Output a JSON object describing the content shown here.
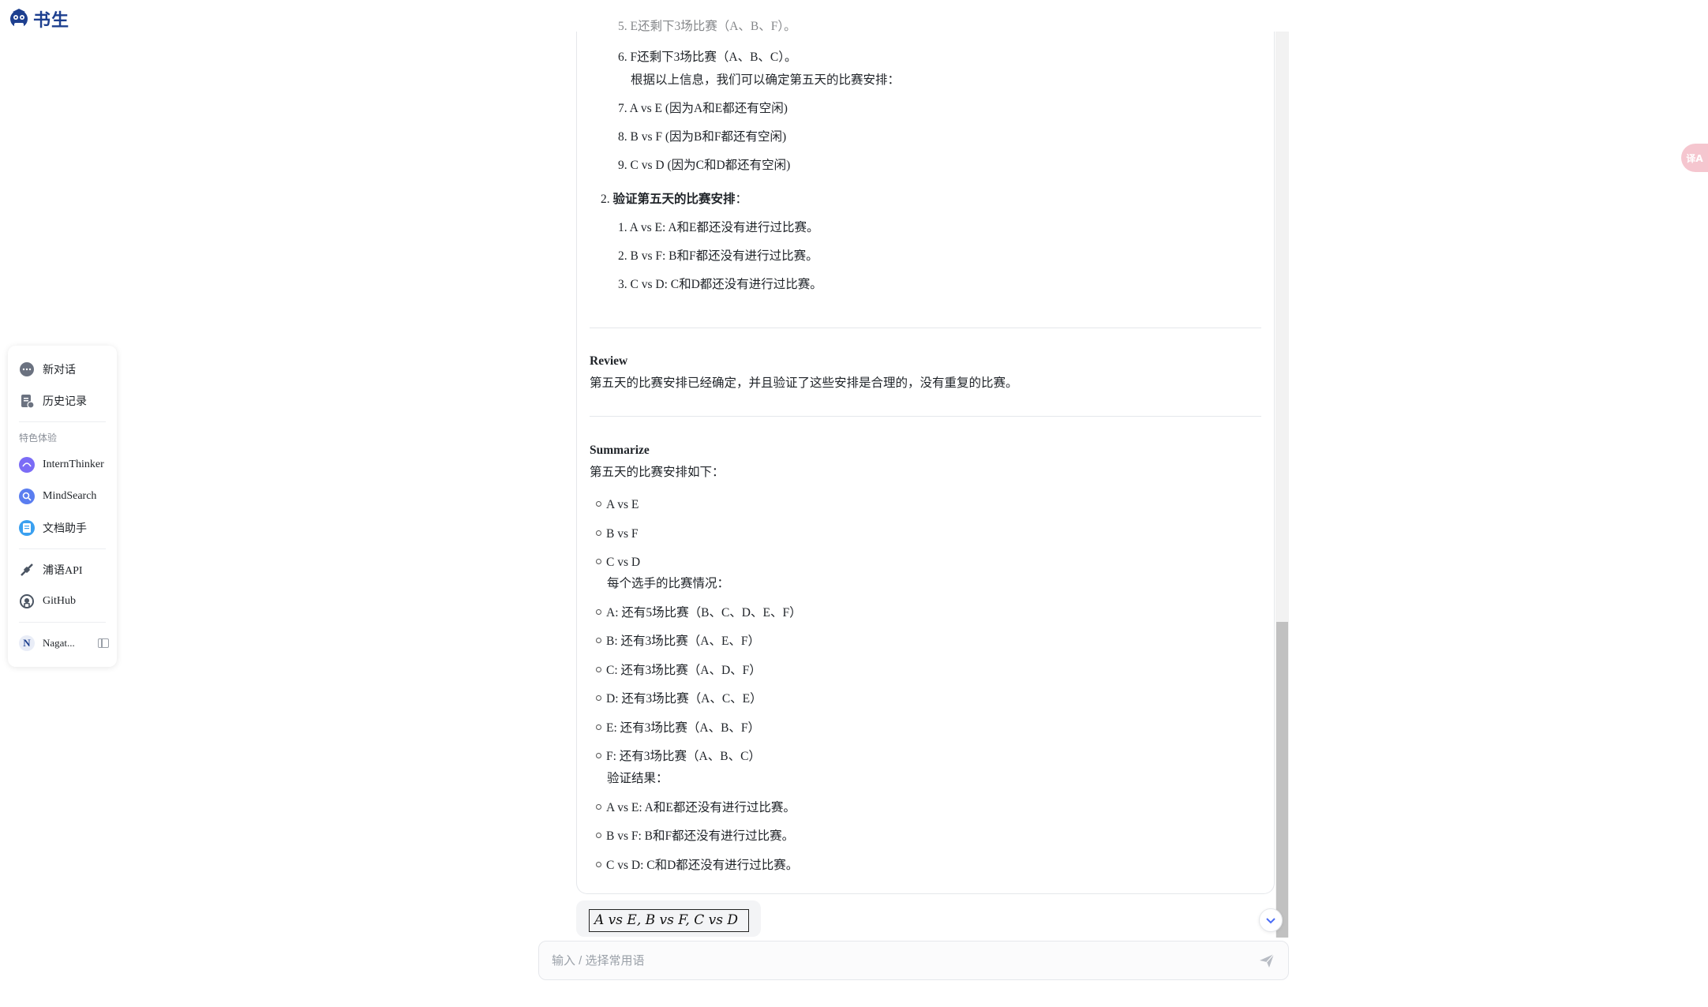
{
  "brand": {
    "name": "书生"
  },
  "sidebar": {
    "new_chat": "新对话",
    "history": "历史记录",
    "section_label": "特色体验",
    "features": [
      {
        "label": "InternThinker",
        "icon": "intern-thinker-icon",
        "color": "#7b6cf6"
      },
      {
        "label": "MindSearch",
        "icon": "mindsearch-icon",
        "color": "#5a7df0"
      },
      {
        "label": "文档助手",
        "icon": "document-icon",
        "color": "#3aa0f0"
      }
    ],
    "links": [
      {
        "label": "浦语API",
        "icon": "api-icon"
      },
      {
        "label": "GitHub",
        "icon": "github-icon"
      }
    ],
    "user": {
      "initial": "N",
      "name": "Nagat..."
    }
  },
  "chat": {
    "top_partial": "5. E还剩下3场比赛（A、B、F）。",
    "list_a": [
      {
        "num": "6.",
        "text": "F还剩下3场比赛（A、B、C）。"
      }
    ],
    "note_a": "根据以上信息，我们可以确定第五天的比赛安排：",
    "list_b": [
      {
        "num": "7.",
        "text": "A vs E (因为A和E都还有空闲)"
      },
      {
        "num": "8.",
        "text": "B vs F (因为B和F都还有空闲)"
      },
      {
        "num": "9.",
        "text": "C vs D (因为C和D都还有空闲)"
      }
    ],
    "step2": {
      "num": "2.",
      "title": "验证第五天的比赛安排",
      "colon": "："
    },
    "verify_list": [
      {
        "num": "1.",
        "text": "A vs E: A和E都还没有进行过比赛。"
      },
      {
        "num": "2.",
        "text": "B vs F: B和F都还没有进行过比赛。"
      },
      {
        "num": "3.",
        "text": "C vs D: C和D都还没有进行过比赛。"
      }
    ],
    "review": {
      "title": "Review",
      "text": "第五天的比赛安排已经确定，并且验证了这些安排是合理的，没有重复的比赛。"
    },
    "summarize": {
      "title": "Summarize",
      "intro": "第五天的比赛安排如下：",
      "matches": [
        "A vs E",
        "B vs F",
        "C vs D"
      ],
      "players_intro": "每个选手的比赛情况：",
      "players": [
        "A: 还有5场比赛（B、C、D、E、F）",
        "B: 还有3场比赛（A、E、F）",
        "C: 还有3场比赛（A、D、F）",
        "D: 还有3场比赛（A、C、E）",
        "E: 还有3场比赛（A、B、F）",
        "F: 还有3场比赛（A、B、C）"
      ],
      "verify_intro": "验证结果：",
      "verify": [
        "A vs E: A和E都还没有进行过比赛。",
        "B vs F: B和F都还没有进行过比赛。",
        "C vs D: C和D都还没有进行过比赛。"
      ]
    },
    "final_answer": "A vs E, B vs F, C vs D"
  },
  "input": {
    "placeholder": "输入 / 选择常用语"
  },
  "translate": {
    "label": "译A"
  }
}
